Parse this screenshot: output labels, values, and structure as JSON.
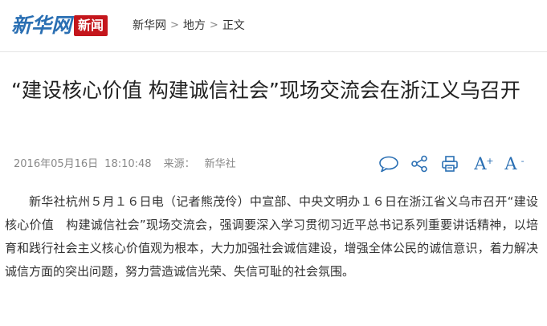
{
  "header": {
    "logo_text": "新华网",
    "logo_badge": "新闻",
    "breadcrumb": [
      {
        "label": "新华网"
      },
      {
        "label": "地方"
      },
      {
        "label": "正文"
      }
    ],
    "separator": ">"
  },
  "article": {
    "title": "“建设核心价值 构建诚信社会”现场交流会在浙江义乌召开",
    "date": "2016年05月16日",
    "time": "18:10:48",
    "source_label": "来源：",
    "source_name": "新华社",
    "body": "新华社杭州５月１６日电（记者熊茂伶）中宣部、中央文明办１６日在浙江省义乌市召开“建设核心价值　构建诚信社会”现场交流会，强调要深入学习贯彻习近平总书记系列重要讲话精神，以培育和践行社会主义核心价值观为根本，大力加强社会诚信建设，增强全体公民的诚信意识，着力解决诚信方面的突出问题，努力营造诚信光荣、失信可耻的社会氛围。"
  },
  "actions": {
    "font_increase_glyph": "A",
    "font_increase_mark": "+",
    "font_decrease_glyph": "A",
    "font_decrease_mark": "-",
    "icons": [
      "comment-icon",
      "share-icon",
      "print-icon",
      "font-increase-icon",
      "font-decrease-icon"
    ]
  },
  "colors": {
    "brand_blue": "#2a6fb3",
    "badge_red": "#c4161c",
    "text": "#333333",
    "meta_gray": "#888888"
  }
}
